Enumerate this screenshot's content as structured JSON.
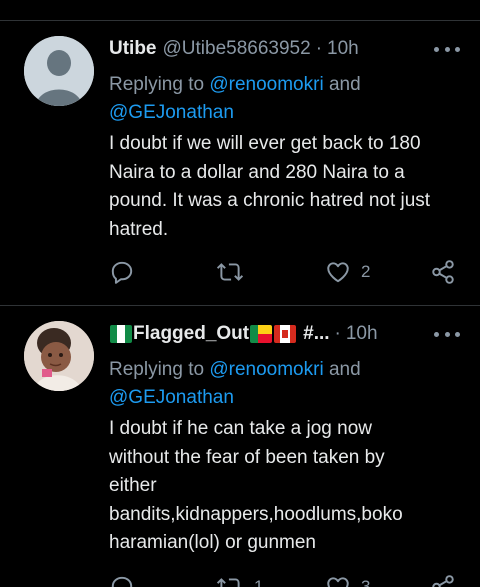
{
  "tweets": [
    {
      "display_name": "Utibe",
      "handle": "@Utibe58663952",
      "separator": "·",
      "time": "10h",
      "replying_prefix": "Replying to ",
      "mention_1": "@renoomokri",
      "replying_and": " and",
      "mention_2": "@GEJonathan",
      "body": "I doubt if we will ever get back to 180 Naira to a dollar and 280 Naira  to a pound.  It was a chronic hatred not just hatred.",
      "reply_count": "",
      "retweet_count": "",
      "like_count": "2"
    },
    {
      "display_name": "Flagged_Out",
      "name_suffix": "#...",
      "separator": "·",
      "time": "10h",
      "replying_prefix": "Replying to ",
      "mention_1": "@renoomokri",
      "replying_and": " and",
      "mention_2": "@GEJonathan",
      "body_lines": [
        "I doubt if he can take a jog now",
        "without the fear of been taken by",
        "either",
        "bandits,kidnappers,hoodlums,boko",
        "haramian(lol) or gunmen"
      ],
      "retweet_count": "1",
      "like_count": "3"
    }
  ],
  "icons": [
    "more-icon",
    "reply-icon",
    "retweet-icon",
    "like-icon",
    "share-icon",
    "nigeria-flag-icon",
    "benin-flag-icon",
    "canada-flag-icon"
  ],
  "colors": {
    "background": "#000000",
    "text": "#e7e9ea",
    "muted": "#8b98a5",
    "link": "#1d9bf0",
    "divider": "#2f3336"
  }
}
